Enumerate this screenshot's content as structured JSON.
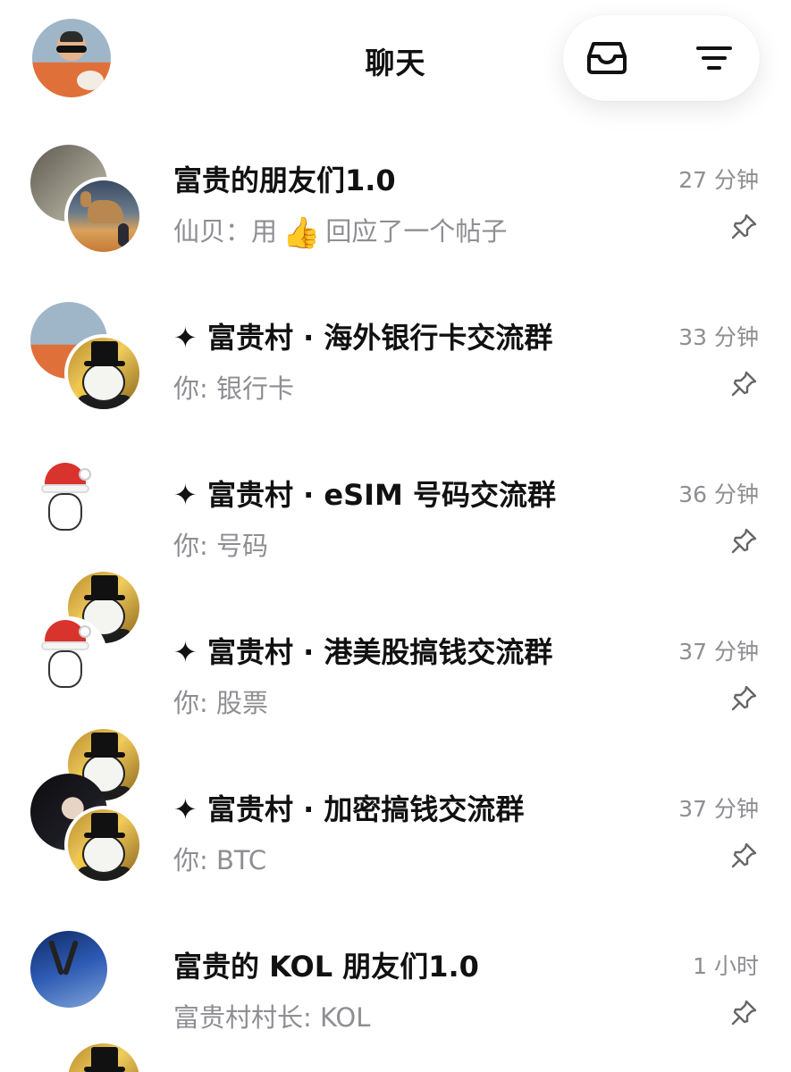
{
  "header": {
    "title": "聊天",
    "inbox_icon": "inbox-icon",
    "filter_icon": "filter-icon"
  },
  "chats": [
    {
      "name": "富贵的朋友们1.0",
      "preview_prefix": "仙贝：用",
      "preview_suffix": "回应了一个帖子",
      "emoji": "👍",
      "time": "27 分钟"
    },
    {
      "name": "✦ 富贵村 · 海外银行卡交流群",
      "preview": "你: 银行卡",
      "time": "33 分钟"
    },
    {
      "name": "✦ 富贵村 · eSIM 号码交流群",
      "preview": "你: 号码",
      "time": "36 分钟"
    },
    {
      "name": "✦ 富贵村 · 港美股搞钱交流群",
      "preview": "你: 股票",
      "time": "37 分钟"
    },
    {
      "name": "✦ 富贵村 · 加密搞钱交流群",
      "preview": "你: BTC",
      "time": "37 分钟"
    },
    {
      "name": "富贵的 KOL 朋友们1.0",
      "preview": "富贵村村长: KOL",
      "time": "1 小时"
    }
  ]
}
